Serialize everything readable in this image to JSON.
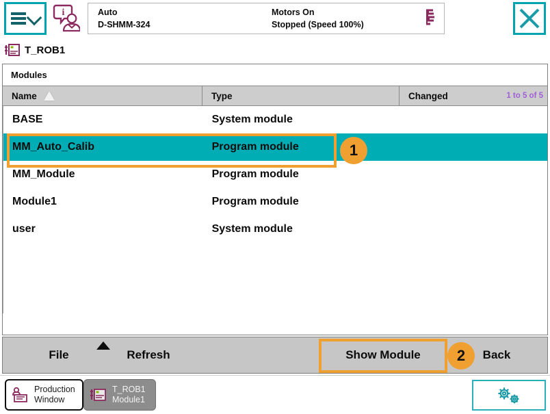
{
  "header": {
    "menu_icon": "hamburger-chevron-icon",
    "operator_icon": "operator-info-icon",
    "mode": "Auto",
    "controller": "D-SHMM-324",
    "motors_state": "Motors On",
    "exec_state": "Stopped (Speed 100%)",
    "robot_icon": "robot-status-icon",
    "close_icon": "close-x-icon",
    "accent_teal": "#00a3b0"
  },
  "task_tab": {
    "icon": "task-module-icon",
    "label": "T_ROB1"
  },
  "panel": {
    "title": "Modules",
    "columns": [
      {
        "key": "name",
        "label": "Name",
        "sort": "ascending"
      },
      {
        "key": "type",
        "label": "Type"
      },
      {
        "key": "changed",
        "label": "Changed"
      }
    ],
    "pager": "1 to 5 of 5",
    "rows": [
      {
        "name": "BASE",
        "type": "System module",
        "changed": "",
        "selected": false
      },
      {
        "name": "MM_Auto_Calib",
        "type": "Program module",
        "changed": "",
        "selected": true
      },
      {
        "name": "MM_Module",
        "type": "Program module",
        "changed": "",
        "selected": false
      },
      {
        "name": "Module1",
        "type": "Program module",
        "changed": "",
        "selected": false
      },
      {
        "name": "user",
        "type": "System module",
        "changed": "",
        "selected": false
      }
    ],
    "selection_color": "#00adb5",
    "pager_color": "#a05fd8"
  },
  "annotations": {
    "badge_1": "1",
    "badge_2": "2",
    "highlight_color": "#f0a030"
  },
  "toolbar": {
    "file_label": "File",
    "file_caret_icon": "caret-up-icon",
    "refresh_label": "Refresh",
    "show_module_label": "Show Module",
    "back_label": "Back"
  },
  "taskbar": {
    "items": [
      {
        "icon": "production-window-icon",
        "line1": "Production",
        "line2": "Window",
        "active": true
      },
      {
        "icon": "program-editor-icon",
        "line1": "T_ROB1",
        "line2": "Module1",
        "active": false
      }
    ],
    "settings_icon": "gears-icon"
  }
}
